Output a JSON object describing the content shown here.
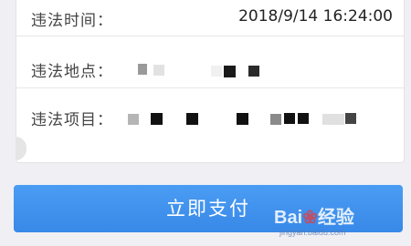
{
  "details": {
    "time_label": "违法时间：",
    "time_value": "2018/9/14 16:24:00",
    "location_label": "违法地点：",
    "item_label": "违法项目："
  },
  "pay_button_label": "立即支付",
  "watermark": {
    "logo": "Bai",
    "logo_suffix": "经验",
    "url": "jingyan.baidu.com"
  },
  "colors": {
    "accent": "#3b8ff0",
    "background": "#efeff4",
    "card": "#ffffff"
  }
}
